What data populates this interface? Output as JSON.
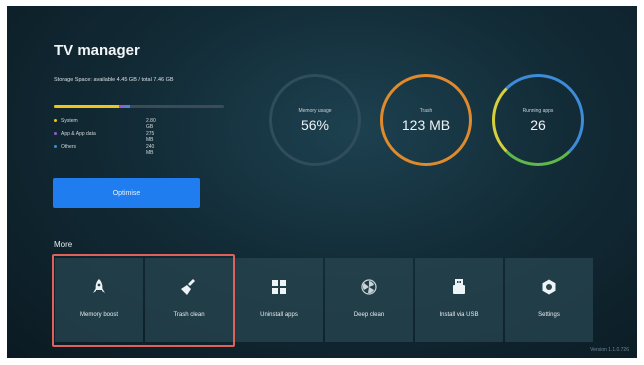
{
  "app": {
    "title": "TV manager"
  },
  "storage": {
    "text": "Storage Space: available 4.45 GB / total 7.46 GB",
    "legend": [
      {
        "label": "System",
        "value": "2.80 GB",
        "color": "#f0c419"
      },
      {
        "label": "App & App data",
        "value": "275 MB",
        "color": "#9b59d0"
      },
      {
        "label": "Others",
        "value": "240 MB",
        "color": "#3d8bd9"
      }
    ],
    "bar_fractions": {
      "system": 0.38,
      "apps": 0.04,
      "others": 0.03
    }
  },
  "optimise_label": "Optimise",
  "gauges": [
    {
      "label": "Memory usage",
      "value": "56%",
      "color": "#3b5968"
    },
    {
      "label": "Trash",
      "value": "123 MB",
      "color": "#e08a2e"
    },
    {
      "label": "Running apps",
      "value": "26",
      "color": "#3d8bd9"
    }
  ],
  "more_label": "More",
  "tools": [
    {
      "label": "Memory boost",
      "icon": "rocket-icon"
    },
    {
      "label": "Trash clean",
      "icon": "broom-icon"
    },
    {
      "label": "Uninstall apps",
      "icon": "grid-icon"
    },
    {
      "label": "Deep clean",
      "icon": "fan-icon"
    },
    {
      "label": "Install via USB",
      "icon": "usb-icon"
    },
    {
      "label": "Settings",
      "icon": "gear-icon"
    }
  ],
  "version": "Version 1.1.0.726"
}
